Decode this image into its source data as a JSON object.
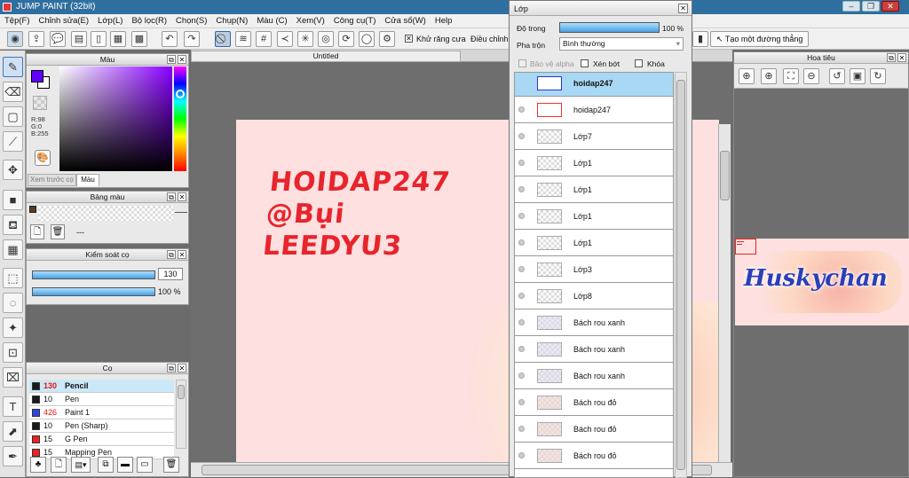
{
  "app": {
    "title": "JUMP PAINT (32bit)"
  },
  "menu": [
    "Tệp(F)",
    "Chỉnh sửa(E)",
    "Lớp(L)",
    "Bộ lọc(R)",
    "Chọn(S)",
    "Chụp(N)",
    "Màu (C)",
    "Xem(V)",
    "Công cụ(T)",
    "Cửa sổ(W)",
    "Help"
  ],
  "toolbar": {
    "antialias": "Khử răng cưa",
    "adjust": "Điều chỉnh",
    "straight_line": "Tạo một đường thẳng"
  },
  "color_panel": {
    "title": "Màu",
    "r": "R:98",
    "g": "G:0",
    "b": "B:255",
    "tab_preview": "Xem trước cọ",
    "tab_color": "Màu",
    "fg": "#6200ff"
  },
  "palette_panel": {
    "title": "Bảng màu",
    "dash": "---"
  },
  "brush_control": {
    "title": "Kiểm soát cọ",
    "size": "130",
    "opacity": "100 %"
  },
  "brush_panel": {
    "title": "Cọ",
    "items": [
      {
        "size": "130",
        "name": "Pencil",
        "color": "#1a1a1a",
        "selected": true
      },
      {
        "size": "10",
        "name": "Pen",
        "color": "#1a1a1a"
      },
      {
        "size": "426",
        "name": "Paint 1",
        "color": "#3344dd"
      },
      {
        "size": "10",
        "name": "Pen (Sharp)",
        "color": "#1a1a1a"
      },
      {
        "size": "15",
        "name": "G Pen",
        "color": "#ee2222"
      },
      {
        "size": "15",
        "name": "Mapping Pen",
        "color": "#ee2222"
      }
    ]
  },
  "canvas": {
    "tab": "Untitled",
    "text1": "HOIDAP247",
    "text2": "@Bụi",
    "text3": "LEEDYU3"
  },
  "layers_panel": {
    "title": "Lớp",
    "opacity_label": "Độ trong",
    "opacity_value": "100 %",
    "blend_label": "Pha trộn",
    "blend_value": "Bình thường",
    "protect_alpha": "Bảo vệ alpha",
    "clip": "Xén bớt",
    "lock": "Khóa",
    "layers": [
      "hoidap247",
      "hoidap247",
      "Lớp7",
      "Lớp1",
      "Lớp1",
      "Lớp1",
      "Lớp1",
      "Lớp3",
      "Lớp8",
      "Bách rou xanh",
      "Bách rou xanh",
      "Bách rou xanh",
      "Bách rou đỏ",
      "Bách rou đỏ",
      "Bách rou đỏ"
    ]
  },
  "navigator": {
    "title": "Hoa tiêu",
    "preview_text": "Huskychan"
  }
}
